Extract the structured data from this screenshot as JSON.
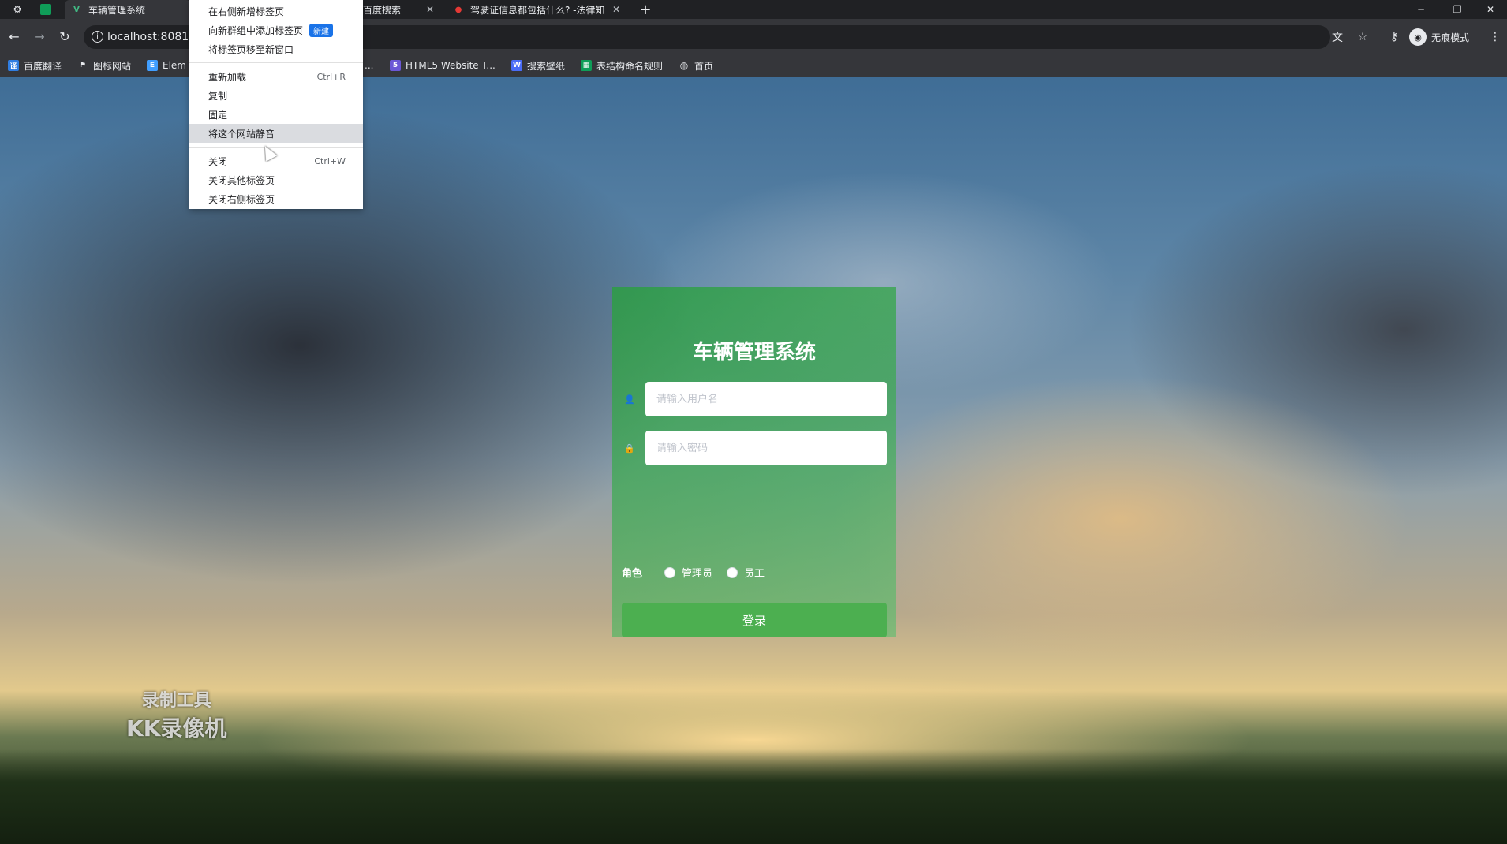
{
  "browser": {
    "tabs": [
      {
        "title": "车辆管理系统",
        "active": true
      },
      {
        "title": "百度搜索",
        "active": false
      },
      {
        "title": "驾驶证信息都包括什么? -法律知",
        "active": false
      }
    ],
    "new_tab_symbol": "+",
    "url": "localhost:8081/",
    "incognito_label": "无痕模式"
  },
  "bookmarks": [
    {
      "label": "百度翻译",
      "icon": "translate-icon",
      "color": "#2f7de1"
    },
    {
      "label": "图标网站",
      "icon": "flag-icon",
      "color": "#5f6368"
    },
    {
      "label": "Elem",
      "icon": "element-icon",
      "color": "#409eff"
    },
    {
      "label": "...",
      "icon": "",
      "color": ""
    },
    {
      "label": "HTML5 Website T...",
      "icon": "html5-icon",
      "color": "#6b57d6"
    },
    {
      "label": "搜索壁纸",
      "icon": "wallpaper-icon",
      "color": "#4a6cf7"
    },
    {
      "label": "表结构命名规则",
      "icon": "sheet-icon",
      "color": "#0f9d58"
    },
    {
      "label": "首页",
      "icon": "globe-icon",
      "color": "#5f6368"
    }
  ],
  "context_menu": {
    "group1": [
      {
        "label": "在右侧新增标签页"
      },
      {
        "label": "向新群组中添加标签页",
        "badge": "新建"
      },
      {
        "label": "将标签页移至新窗口"
      }
    ],
    "group2": [
      {
        "label": "重新加载",
        "shortcut": "Ctrl+R"
      },
      {
        "label": "复制"
      },
      {
        "label": "固定"
      },
      {
        "label": "将这个网站静音",
        "highlighted": true
      }
    ],
    "group3": [
      {
        "label": "关闭",
        "shortcut": "Ctrl+W"
      },
      {
        "label": "关闭其他标签页"
      },
      {
        "label": "关闭右侧标签页"
      }
    ]
  },
  "login": {
    "title": "车辆管理系统",
    "username_placeholder": "请输入用户名",
    "password_placeholder": "请输入密码",
    "role_label": "角色",
    "roles": [
      "管理员",
      "员工"
    ],
    "submit_label": "登录"
  },
  "watermark": {
    "line1": "录制工具",
    "line2": "KK录像机"
  },
  "colors": {
    "accent_green": "#4caf50",
    "menu_badge_blue": "#1a73e8",
    "browser_dark": "#202124"
  }
}
